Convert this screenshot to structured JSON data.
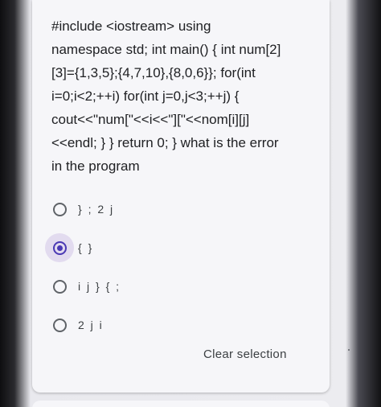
{
  "question": {
    "lines": [
      "#include <iostream> using",
      "namespace std; int main() { int num[2]",
      "[3]={1,3,5};{4,7,10},{8,0,6}}; for(int",
      "i=0;i<2;++i) for(int j=0,j<3;++j) {",
      "cout<<\"num[\"<<i<<\"][\"<<nom[i][j]",
      "<<endl; } } return 0; } what is the error",
      "in the program"
    ]
  },
  "options": [
    {
      "label": "} ; 2 j",
      "selected": false
    },
    {
      "label": "{ }",
      "selected": true
    },
    {
      "label": "i j } { ;",
      "selected": false
    },
    {
      "label": "2 j i",
      "selected": false
    }
  ],
  "clear_selection_label": "Clear selection",
  "colors": {
    "accent": "#4a39b4",
    "card_background": "#f6f6f9",
    "text": "#202124"
  }
}
